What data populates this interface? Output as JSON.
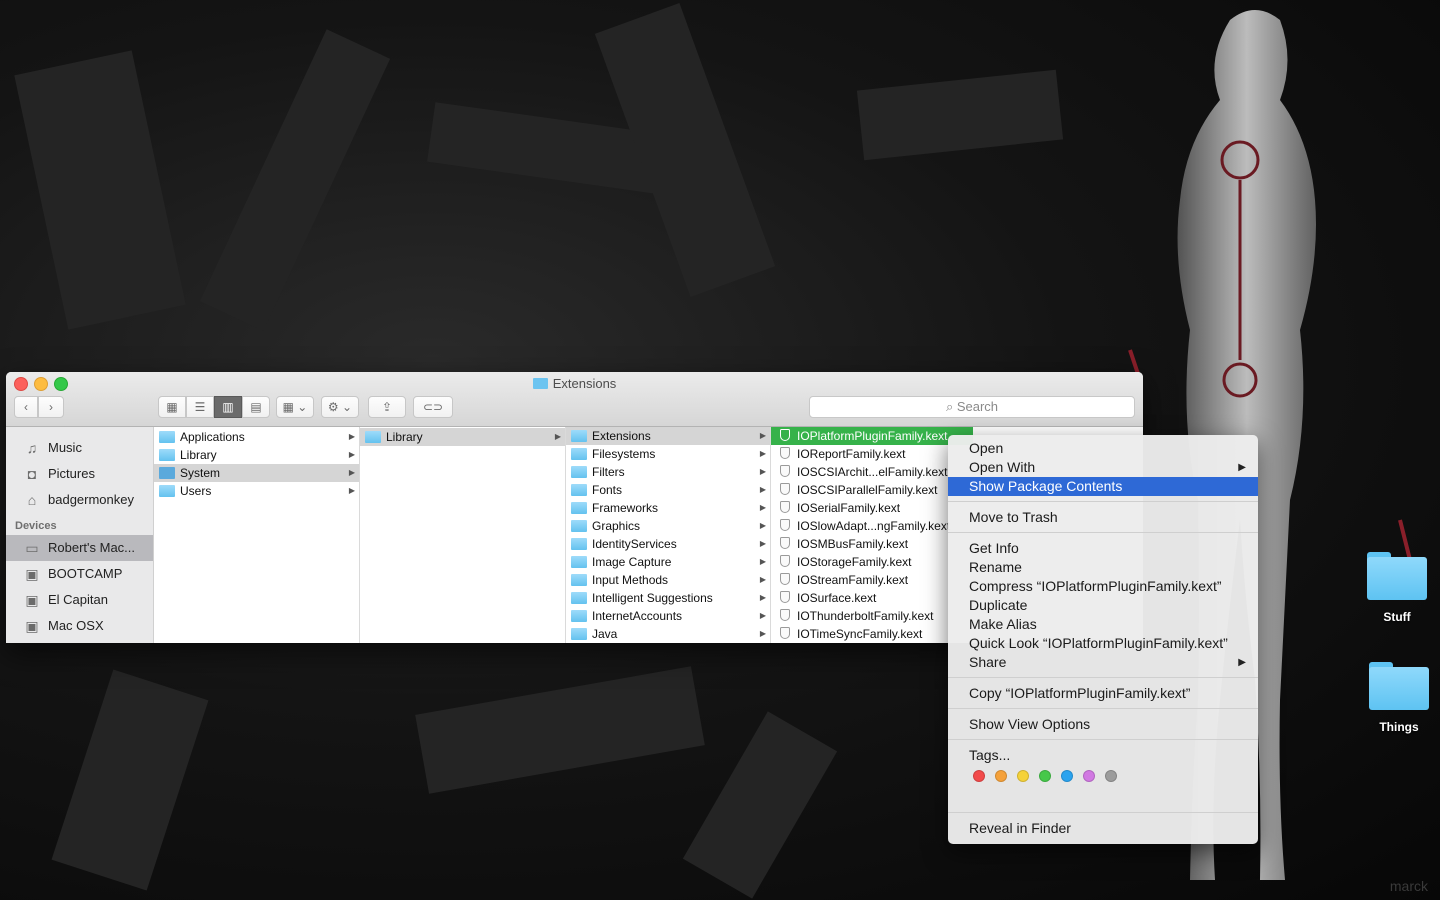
{
  "window": {
    "title": "Extensions",
    "toolbar": {
      "back_icon": "‹",
      "forward_icon": "›",
      "view_icons": "▦",
      "view_list": "☰",
      "view_columns": "▥",
      "view_coverflow": "▤",
      "arrange_icon": "▦ ⌄",
      "action_icon": "⚙ ⌄",
      "share_icon": "⇪",
      "tag_icon": "⊂⊃",
      "search_placeholder": "Search"
    }
  },
  "sidebar": {
    "favorites": [
      {
        "label": "Music",
        "icon": "♫"
      },
      {
        "label": "Pictures",
        "icon": "◘"
      },
      {
        "label": "badgermonkey",
        "icon": "⌂"
      }
    ],
    "devices_header": "Devices",
    "devices": [
      {
        "label": "Robert's Mac...",
        "icon": "▭",
        "selected": true
      },
      {
        "label": "BOOTCAMP",
        "icon": "▣"
      },
      {
        "label": "El Capitan",
        "icon": "▣"
      },
      {
        "label": "Mac OSX",
        "icon": "▣"
      }
    ]
  },
  "columns": {
    "c1": [
      "Applications",
      "Library",
      "System",
      "Users"
    ],
    "c2": [
      "Library"
    ],
    "c3": [
      "Extensions",
      "Filesystems",
      "Filters",
      "Fonts",
      "Frameworks",
      "Graphics",
      "IdentityServices",
      "Image Capture",
      "Input Methods",
      "Intelligent Suggestions",
      "InternetAccounts",
      "Java"
    ],
    "c4": [
      "IOPlatformPluginFamily.kext",
      "IOReportFamily.kext",
      "IOSCSIArchit...elFamily.kext",
      "IOSCSIParallelFamily.kext",
      "IOSerialFamily.kext",
      "IOSlowAdapt...ngFamily.kext",
      "IOSMBusFamily.kext",
      "IOStorageFamily.kext",
      "IOStreamFamily.kext",
      "IOSurface.kext",
      "IOThunderboltFamily.kext",
      "IOTimeSyncFamily.kext"
    ]
  },
  "context_menu": {
    "open": "Open",
    "open_with": "Open With",
    "show_package_contents": "Show Package Contents",
    "move_to_trash": "Move to Trash",
    "get_info": "Get Info",
    "rename": "Rename",
    "compress": "Compress “IOPlatformPluginFamily.kext”",
    "duplicate": "Duplicate",
    "make_alias": "Make Alias",
    "quick_look": "Quick Look “IOPlatformPluginFamily.kext”",
    "share": "Share",
    "copy": "Copy “IOPlatformPluginFamily.kext”",
    "show_view_options": "Show View Options",
    "tags": "Tags...",
    "reveal_in_finder": "Reveal in Finder",
    "submenu_arrow": "▶",
    "tag_colors": [
      "#f24a4a",
      "#f5a13a",
      "#f5d23a",
      "#46c84a",
      "#2aa3ef",
      "#d178e2",
      "#9c9c9c"
    ]
  },
  "desktop": {
    "icons": [
      "Stuff",
      "Things"
    ],
    "watermark": "marck"
  }
}
